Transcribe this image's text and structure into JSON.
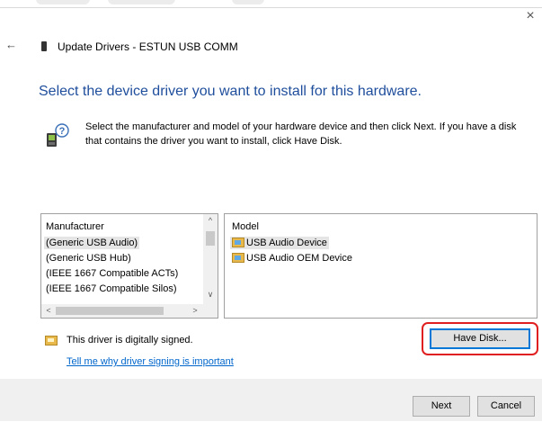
{
  "window": {
    "title": "Update Drivers - ESTUN USB COMM",
    "close_glyph": "×",
    "back_glyph": "←"
  },
  "heading": "Select the device driver you want to install for this hardware.",
  "instruction": "Select the manufacturer and model of your hardware device and then click Next. If you have a disk that contains the driver you want to install, click Have Disk.",
  "manufacturer_list": {
    "header": "Manufacturer",
    "items": [
      "(Generic USB Audio)",
      "(Generic USB Hub)",
      "(IEEE 1667 Compatible ACTs)",
      "(IEEE 1667 Compatible Silos)"
    ],
    "selected_index": 0
  },
  "model_list": {
    "header": "Model",
    "items": [
      "USB Audio Device",
      "USB Audio OEM Device"
    ],
    "selected_index": 0
  },
  "signing": {
    "status": "This driver is digitally signed.",
    "link": "Tell me why driver signing is important"
  },
  "buttons": {
    "have_disk": "Have Disk...",
    "next": "Next",
    "cancel": "Cancel"
  },
  "icons": {
    "back": "back-arrow-icon",
    "device": "usb-device-icon",
    "hardware": "hardware-help-icon",
    "certificate": "certificate-icon"
  },
  "colors": {
    "heading": "#1f4e9c",
    "link": "#0066cc",
    "highlight_box": "#e02020",
    "focus_border": "#0078d7"
  }
}
